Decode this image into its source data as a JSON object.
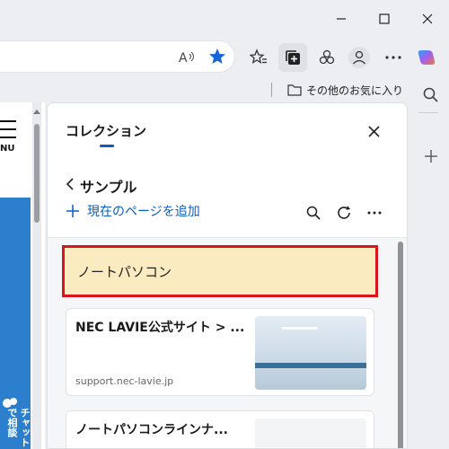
{
  "colors": {
    "accent": "#0a5ec2",
    "highlight_fill": "#fbebc0",
    "highlight_border": "#d9141c",
    "favorite_star": "#1565d8"
  },
  "favorites_bar": {
    "other_favorites": "その他のお気に入り"
  },
  "page": {
    "menu_label": "NU",
    "chat_label": "チャットで相談"
  },
  "collections": {
    "pane_title": "コレクション",
    "collection_name": "サンプル",
    "add_current_page": "現在のページを追加",
    "items": [
      {
        "type": "note",
        "text": "ノートパソコン"
      },
      {
        "type": "page",
        "title": "NEC LAVIE公式サイト > ...",
        "url": "support.nec-lavie.jp"
      },
      {
        "type": "page",
        "title": "ノートパソコンラインナ...",
        "url": ""
      }
    ]
  }
}
